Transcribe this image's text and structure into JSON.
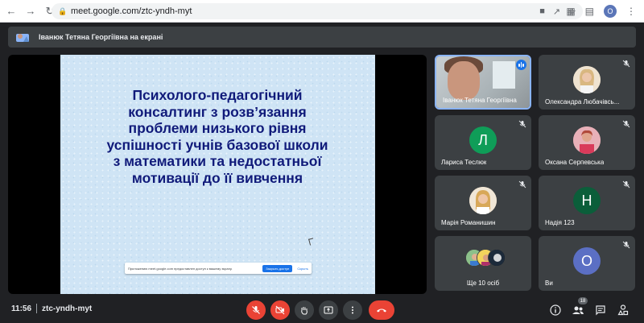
{
  "browser": {
    "url": "meet.google.com/ztc-yndh-myt",
    "profile_initial": "O"
  },
  "banner": {
    "text": "Іванюк Тетяна Георгіївна на екрані"
  },
  "slide": {
    "title": "Психолого-педагогічний\nконсалтинг  з  розв’язання\nпроблеми низького рівня\nуспішності учнів базової школи\nз математики та недостатньої\nмотивації до її вивчення"
  },
  "share_notice": {
    "text": "Приложению meet.google.com предоставлен доступ к вашему экрану.",
    "stop_label": "Закрыть доступ",
    "hide_label": "Скрыть"
  },
  "participants": [
    {
      "name": "Іванюк Тетяна Георгіївна",
      "type": "video",
      "speaking": true
    },
    {
      "name": "Олександра Любачівсь...",
      "type": "photo",
      "color": "#e8d4b8"
    },
    {
      "name": "Лариса Теслюк",
      "type": "initial",
      "initial": "Л",
      "color": "#0f9d58"
    },
    {
      "name": "Оксана Серпевська",
      "type": "photo",
      "color": "#d9a3a8"
    },
    {
      "name": "Марія Романишин",
      "type": "photo",
      "color": "#e5c9a3"
    },
    {
      "name": "Надія 123",
      "type": "initial",
      "initial": "Н",
      "color": "#0b5e3a"
    },
    {
      "name": "Ще 10 осіб",
      "type": "group"
    },
    {
      "name": "Ви",
      "type": "initial",
      "initial": "О",
      "color": "#5b6fc4"
    }
  ],
  "meeting": {
    "time": "11:56",
    "code": "ztc-yndh-myt",
    "people_count": "18"
  },
  "colors": {
    "background": "#202124",
    "tile": "#3c4043",
    "danger": "#ea4335",
    "accent": "#1a73e8",
    "slide_text": "#101a7a"
  }
}
